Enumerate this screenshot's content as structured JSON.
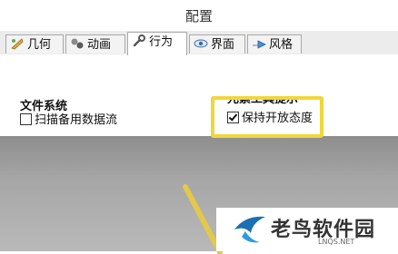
{
  "window": {
    "title": "配置"
  },
  "tabs": [
    {
      "label": "几何",
      "icon": "geometry-icon"
    },
    {
      "label": "动画",
      "icon": "animation-icon"
    },
    {
      "label": "行为",
      "icon": "wrench-icon",
      "active": true
    },
    {
      "label": "界面",
      "icon": "eye-icon"
    },
    {
      "label": "风格",
      "icon": "style-icon"
    }
  ],
  "file_system": {
    "title": "文件系统",
    "option": {
      "label": "扫描备用数据流",
      "checked": false
    }
  },
  "element_tooltip": {
    "title": "元素工具提示",
    "option": {
      "label": "保持开放态度",
      "checked": true
    }
  },
  "watermark": {
    "text": "老鸟软件园",
    "sub": "LNQS.NET"
  },
  "colors": {
    "highlight": "#f1d63a",
    "overlay": "#a3a3a3"
  }
}
